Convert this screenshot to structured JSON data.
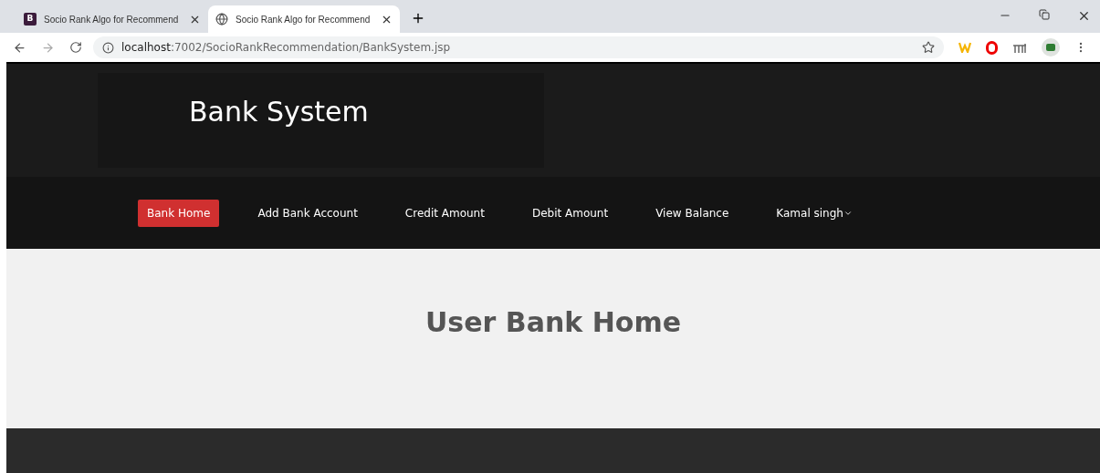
{
  "browser": {
    "tabs": [
      {
        "title": "Socio Rank Algo for Recommend",
        "kind": "logo",
        "logo": "B",
        "selected": false
      },
      {
        "title": "Socio Rank Algo for Recommend",
        "kind": "globe",
        "selected": true
      }
    ],
    "address": {
      "host": "localhost",
      "rest": ":7002/SocioRankRecommendation/BankSystem.jsp"
    }
  },
  "header": {
    "title": "Bank System"
  },
  "nav": [
    {
      "label": "Bank Home",
      "selected": true,
      "kind": "link"
    },
    {
      "label": "Add Bank Account",
      "selected": false,
      "kind": "link"
    },
    {
      "label": "Credit Amount",
      "selected": false,
      "kind": "link"
    },
    {
      "label": "Debit Amount",
      "selected": false,
      "kind": "link"
    },
    {
      "label": "View Balance",
      "selected": false,
      "kind": "link"
    },
    {
      "label": "Kamal singh",
      "selected": false,
      "kind": "dropdown"
    }
  ],
  "main": {
    "heading": "User Bank Home"
  }
}
